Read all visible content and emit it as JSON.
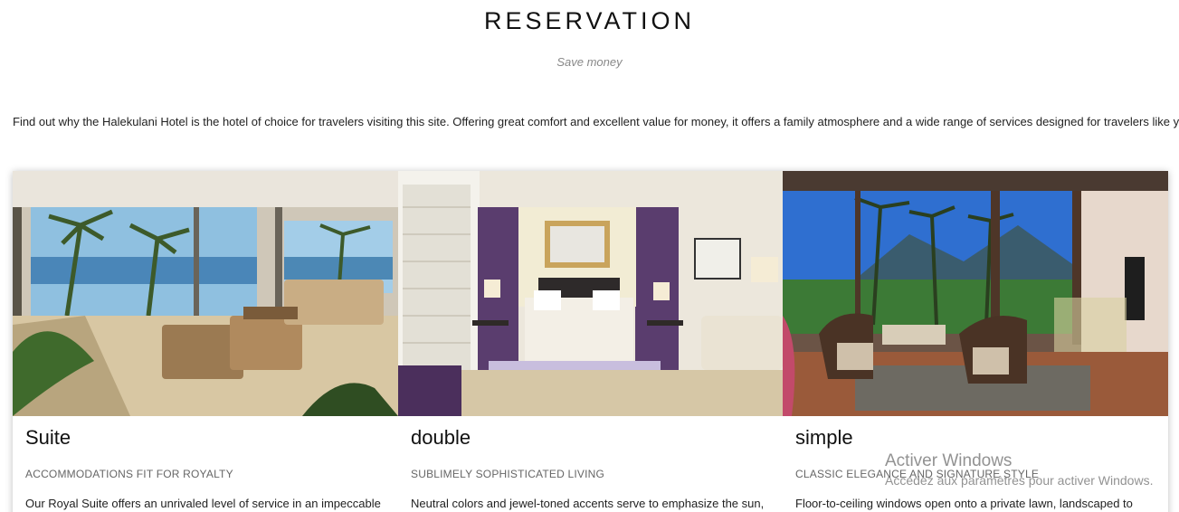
{
  "header": {
    "title": "RESERVATION",
    "subtitle": "Save money"
  },
  "intro": "Find out why the Halekulani Hotel is the hotel of choice for travelers visiting this site. Offering great comfort and excellent value for money, it offers a family atmosphere and a wide range of services designed for travelers like you.",
  "rooms": [
    {
      "title": "Suite",
      "tagline": "ACCOMMODATIONS FIT FOR ROYALTY",
      "description": "Our Royal Suite offers an unrivaled level of service in an impeccable"
    },
    {
      "title": "double",
      "tagline": "SUBLIMELY SOPHISTICATED LIVING",
      "description": "Neutral colors and jewel-toned accents serve to emphasize the sun,"
    },
    {
      "title": "simple",
      "tagline": "CLASSIC ELEGANCE AND SIGNATURE STYLE",
      "description": "Floor-to-ceiling windows open onto a private lawn, landscaped to"
    }
  ],
  "watermark": {
    "title": "Activer Windows",
    "subtitle": "Accédez aux paramètres pour activer Windows."
  }
}
